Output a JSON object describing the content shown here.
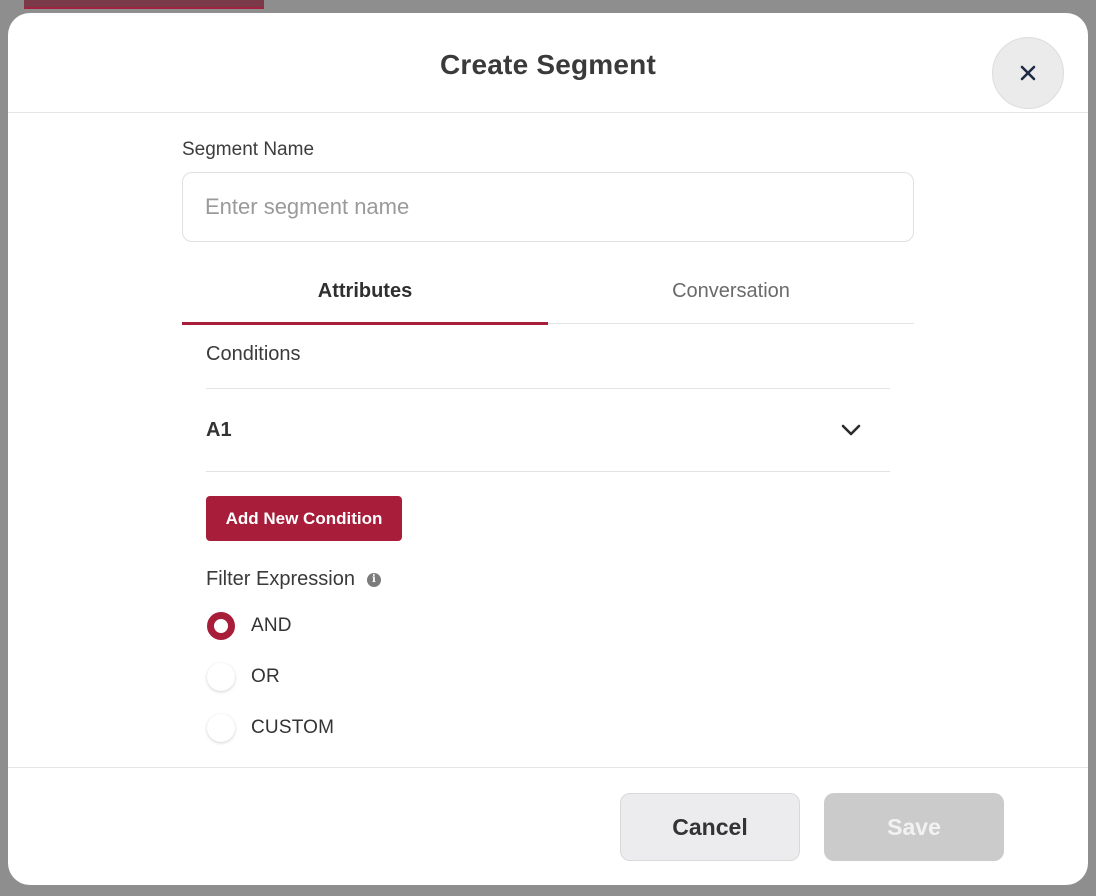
{
  "modal": {
    "title": "Create Segment",
    "close_icon": "close-icon"
  },
  "segment_name": {
    "label": "Segment Name",
    "value": "",
    "placeholder": "Enter segment name"
  },
  "tabs": [
    {
      "label": "Attributes",
      "active": true
    },
    {
      "label": "Conversation",
      "active": false
    }
  ],
  "conditions": {
    "heading": "Conditions",
    "items": [
      {
        "name": "A1",
        "expand_icon": "chevron-down-icon"
      }
    ],
    "add_button_label": "Add New Condition"
  },
  "filter_expression": {
    "label": "Filter Expression",
    "info_icon": "info-icon",
    "options": [
      {
        "label": "AND",
        "selected": true
      },
      {
        "label": "OR",
        "selected": false
      },
      {
        "label": "CUSTOM",
        "selected": false
      }
    ]
  },
  "footer": {
    "cancel_label": "Cancel",
    "save_label": "Save",
    "save_enabled": false
  },
  "colors": {
    "accent": "#a71d3a",
    "overlay": "#8e8e8e",
    "disabled": "#cbcbcb"
  }
}
